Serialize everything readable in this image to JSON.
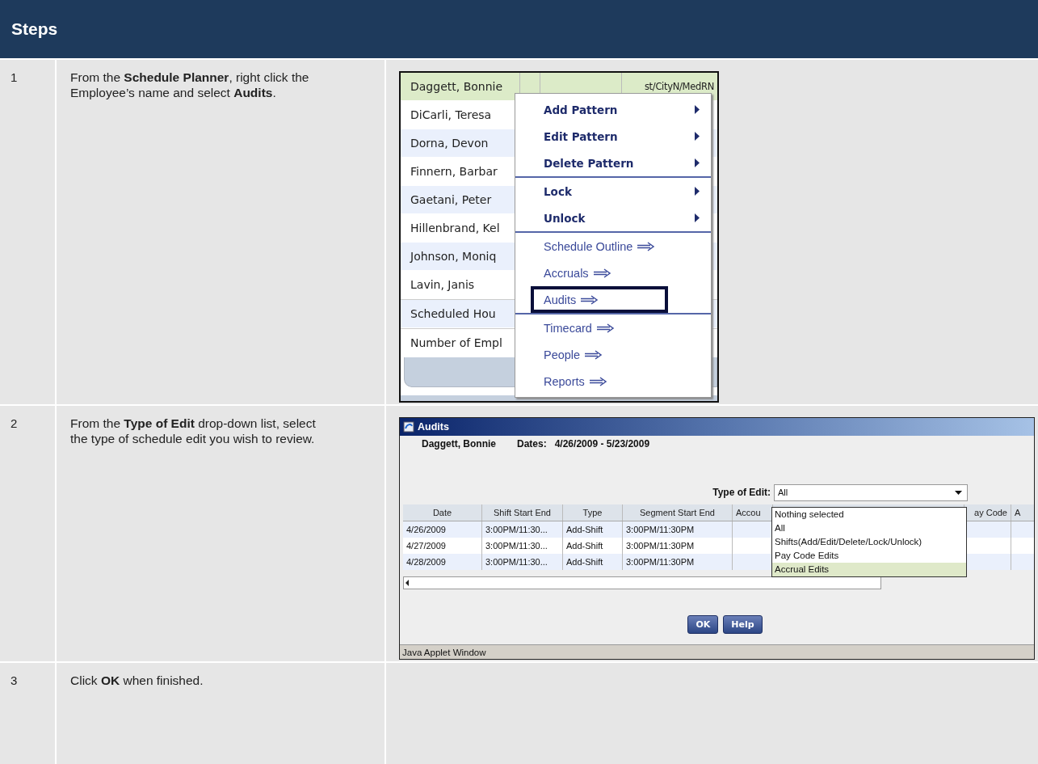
{
  "header": {
    "title": "Steps"
  },
  "steps": [
    {
      "number": "1",
      "text": "From the **Schedule Planner**, right click the Employee’s name and select **Audits**.",
      "screenshot": {
        "kind": "planner",
        "rows": [
          {
            "name": "Daggett, Bonnie",
            "kind": "employee",
            "selected": true,
            "detail": "st/CityN/MedRN"
          },
          {
            "name": "DiCarli, Teresa",
            "kind": "employee",
            "selected": false
          },
          {
            "name": "Dorna, Devon",
            "kind": "employee",
            "selected": false
          },
          {
            "name": "Finnern, Barbar",
            "kind": "employee",
            "selected": false
          },
          {
            "name": "Gaetani, Peter",
            "kind": "employee",
            "selected": false
          },
          {
            "name": "Hillenbrand, Kel",
            "kind": "employee",
            "selected": false
          },
          {
            "name": "Johnson, Moniq",
            "kind": "employee",
            "selected": false
          },
          {
            "name": "Lavin, Janis",
            "kind": "employee",
            "selected": false
          },
          {
            "name": "Scheduled Hou",
            "kind": "total",
            "selected": false
          },
          {
            "name": "Number of Empl",
            "kind": "total",
            "selected": false
          }
        ],
        "menu_groups": [
          [
            {
              "label": "Add Pattern",
              "kind": "submenu",
              "highlighted": false
            },
            {
              "label": "Edit Pattern",
              "kind": "submenu",
              "highlighted": false
            },
            {
              "label": "Delete Pattern",
              "kind": "submenu",
              "highlighted": false
            }
          ],
          [
            {
              "label": "Lock",
              "kind": "submenu",
              "highlighted": false
            },
            {
              "label": "Unlock",
              "kind": "submenu",
              "highlighted": false
            }
          ],
          [
            {
              "label": "Schedule Outline",
              "kind": "link",
              "highlighted": false
            },
            {
              "label": "Accruals",
              "kind": "link",
              "highlighted": false
            },
            {
              "label": "Audits",
              "kind": "link",
              "highlighted": true
            }
          ],
          [
            {
              "label": "Timecard",
              "kind": "link",
              "highlighted": false
            },
            {
              "label": "People",
              "kind": "link",
              "highlighted": false
            },
            {
              "label": "Reports",
              "kind": "link",
              "highlighted": false
            }
          ]
        ]
      }
    },
    {
      "number": "2",
      "text": "From the **Type of Edit** drop-down list, select the type of schedule edit you wish to review.",
      "screenshot": {
        "kind": "audits",
        "title": "Audits",
        "employee": "Daggett, Bonnie",
        "dates_label": "Dates:",
        "dates": "4/26/2009 - 5/23/2009",
        "filter_label": "Type of Edit:",
        "filter_value": "All",
        "options": [
          {
            "label": "Nothing selected",
            "selected": false
          },
          {
            "label": "All",
            "selected": false
          },
          {
            "label": "Shifts(Add/Edit/Delete/Lock/Unlock)",
            "selected": false
          },
          {
            "label": "Pay Code Edits",
            "selected": false
          },
          {
            "label": "Accrual Edits",
            "selected": true
          }
        ],
        "columns": [
          "Date",
          "Shift Start End",
          "Type",
          "Segment Start End",
          "Accou",
          "ay Code",
          "A"
        ],
        "rows": [
          [
            "4/26/2009",
            "3:00PM/11:30...",
            "Add-Shift",
            "3:00PM/11:30PM"
          ],
          [
            "4/27/2009",
            "3:00PM/11:30...",
            "Add-Shift",
            "3:00PM/11:30PM"
          ],
          [
            "4/28/2009",
            "3:00PM/11:30...",
            "Add-Shift",
            "3:00PM/11:30PM"
          ]
        ],
        "buttons": [
          "OK",
          "Help"
        ],
        "status_bar": "Java Applet Window"
      }
    },
    {
      "number": "3",
      "text": "Click **OK** when finished."
    }
  ]
}
